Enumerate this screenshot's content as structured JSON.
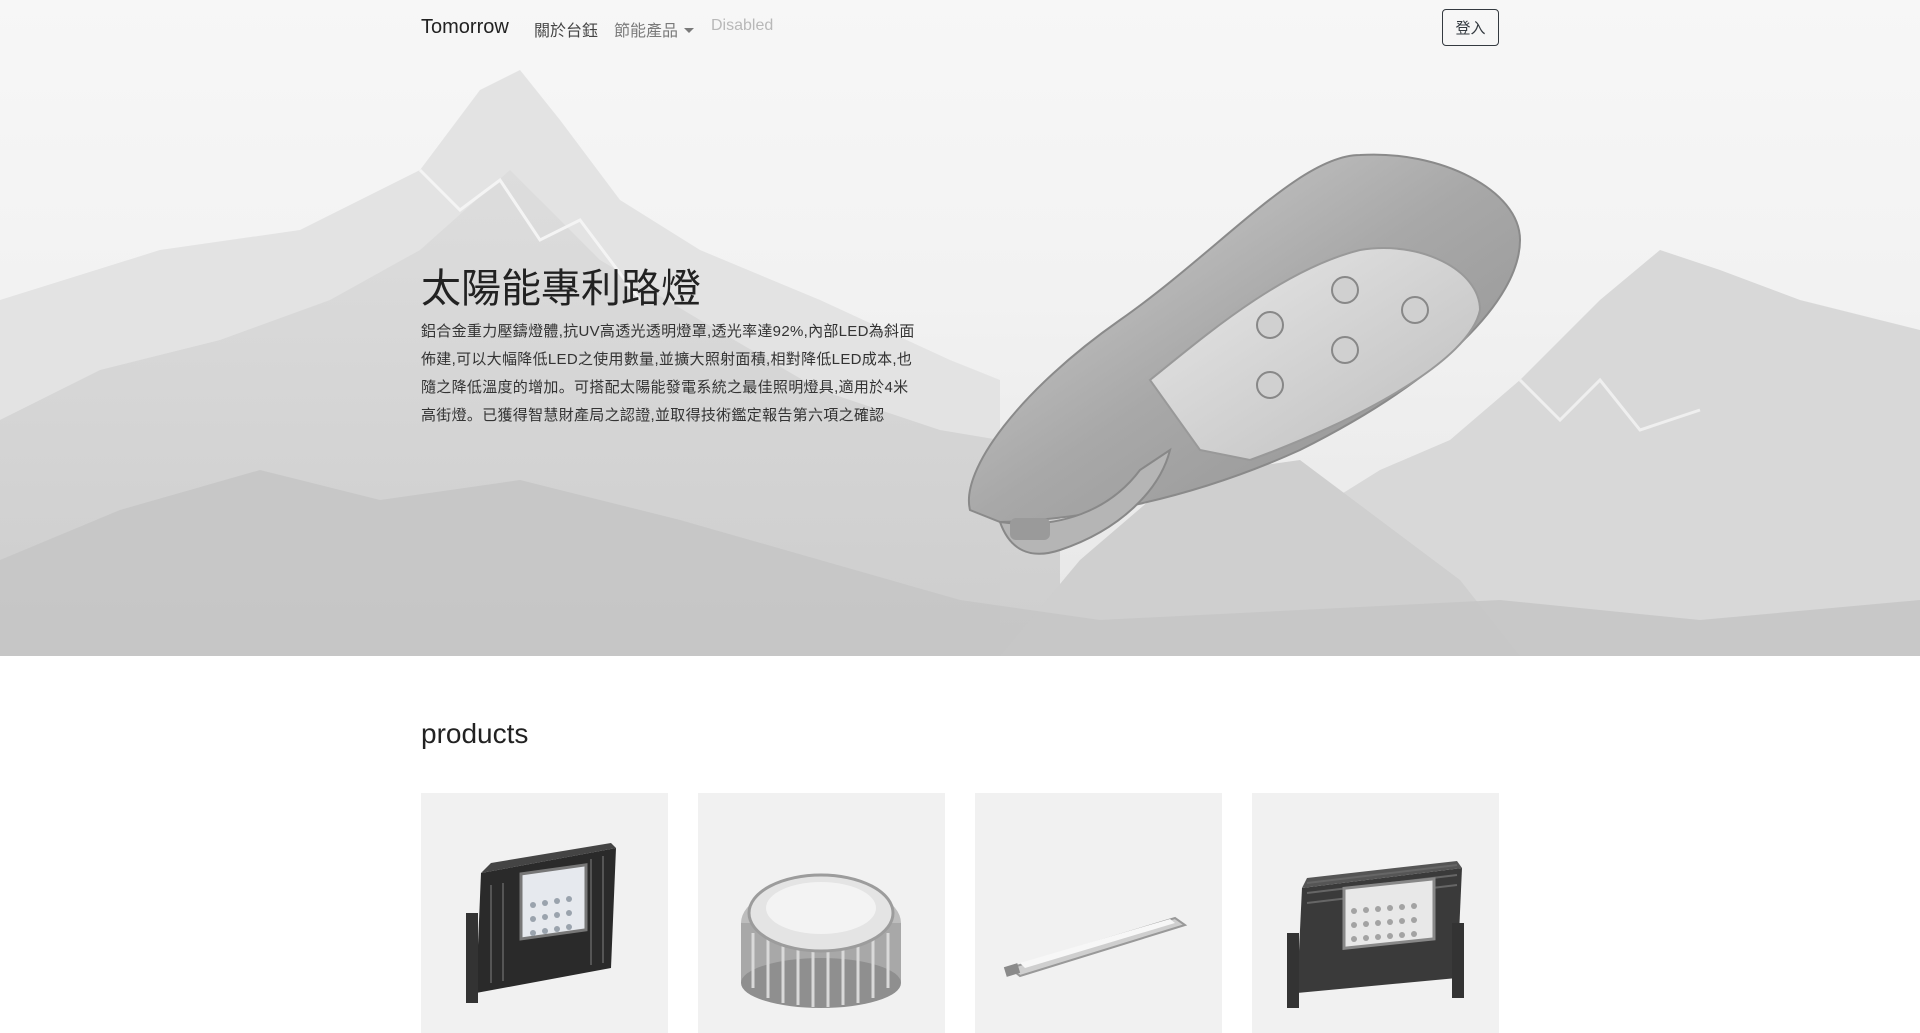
{
  "navbar": {
    "brand": "Tomorrow",
    "links": [
      {
        "label": "關於台鈺",
        "state": "normal"
      },
      {
        "label": "節能產品",
        "state": "dropdown",
        "icon": "caret-down-icon"
      },
      {
        "label": "Disabled",
        "state": "disabled"
      }
    ],
    "login_label": "登入"
  },
  "hero": {
    "title": "太陽能專利路燈",
    "description": "鋁合金重力壓鑄燈體,抗UV高透光透明燈罩,透光率達92%,內部LED為斜面佈建,可以大幅降低LED之使用數量,並擴大照射面積,相對降低LED成本,也隨之降低溫度的增加。可搭配太陽能發電系統之最佳照明燈具,適用於4米高街燈。已獲得智慧財產局之認證,並取得技術鑑定報告第六項之確認",
    "image": "street-lamp-image"
  },
  "products": {
    "heading": "products",
    "cards": [
      {
        "image": "floodlight-image"
      },
      {
        "image": "round-led-light-image"
      },
      {
        "image": "linear-led-bar-image"
      },
      {
        "image": "dual-floodlight-image"
      }
    ]
  },
  "colors": {
    "text": "#212529",
    "nav_muted": "#7a7a7a",
    "nav_disabled": "#b8b8b8",
    "card_bg": "#f1f1f1"
  }
}
